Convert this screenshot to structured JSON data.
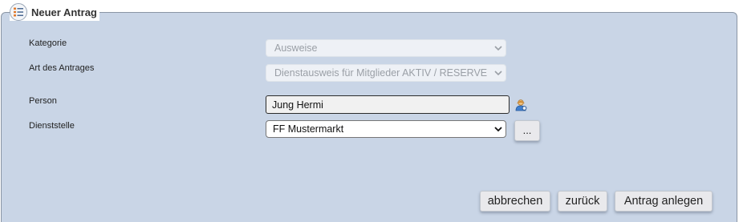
{
  "form": {
    "title": "Neuer Antrag",
    "title_icon": "form-list-icon",
    "fields": {
      "kategorie": {
        "label": "Kategorie",
        "value": "Ausweise"
      },
      "art": {
        "label": "Art des Antrages",
        "value": "Dienstausweis für Mitglieder AKTIV / RESERVE"
      },
      "person": {
        "label": "Person",
        "value": "Jung Hermi",
        "icon": "person-search-icon"
      },
      "dienststelle": {
        "label": "Dienststelle",
        "value": "FF Mustermarkt",
        "more_label": "..."
      }
    },
    "actions": {
      "cancel": "abbrechen",
      "back": "zurück",
      "create": "Antrag anlegen"
    }
  },
  "colors": {
    "panel_bg": "#c9d5e6",
    "panel_border": "#8a95a4",
    "button_bg": "#e9e9ec"
  }
}
